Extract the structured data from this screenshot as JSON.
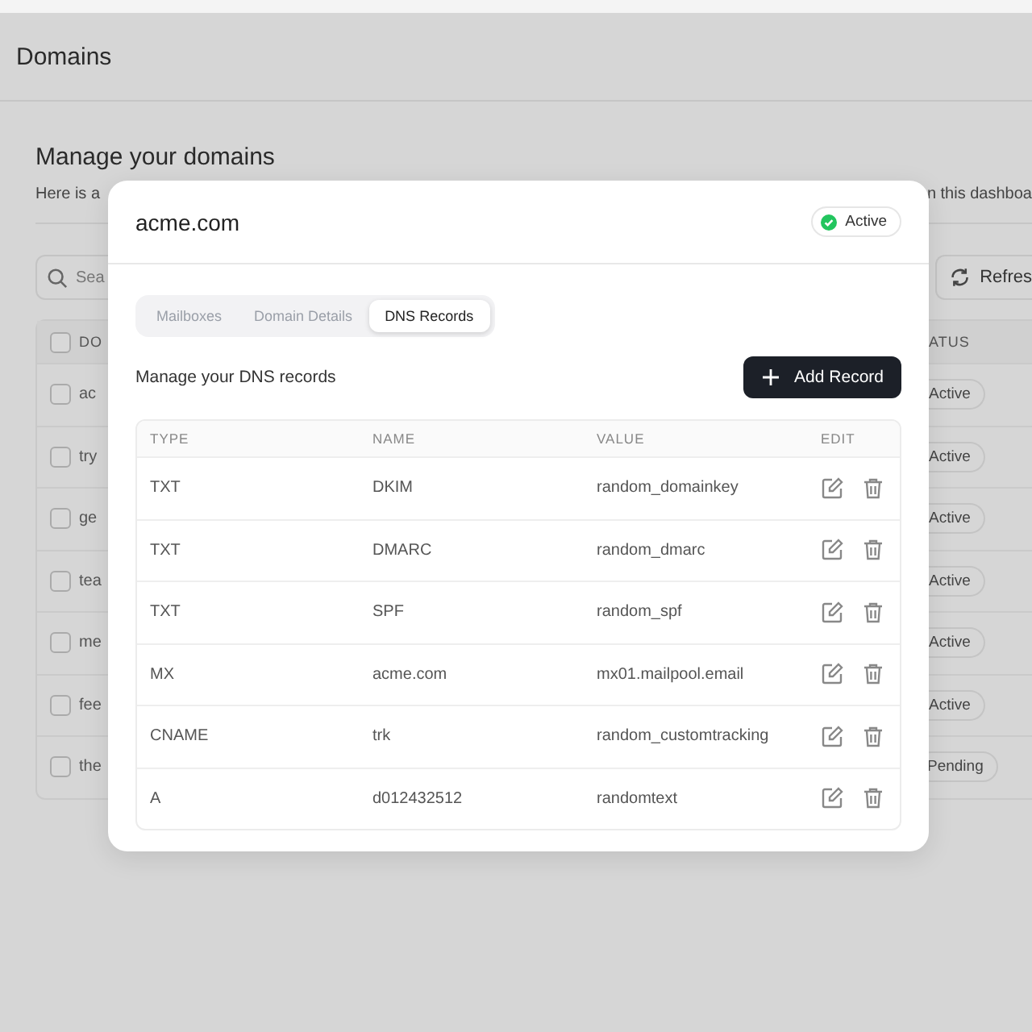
{
  "page": {
    "title": "Domains",
    "heading": "Manage your domains",
    "description_start": "Here is a",
    "description_end": "n this dashboa",
    "search": {
      "placeholder": "Sea"
    },
    "refresh_button": "Refres",
    "table": {
      "columns": [
        "DO",
        "ATUS"
      ],
      "header_checkbox": {
        "checked": false
      },
      "rows": [
        {
          "domain": "ac",
          "checked": false,
          "status": "Active",
          "kind": "active"
        },
        {
          "domain": "try",
          "checked": false,
          "status": "Active",
          "kind": "active"
        },
        {
          "domain": "ge",
          "checked": false,
          "status": "Active",
          "kind": "active"
        },
        {
          "domain": "tea",
          "checked": false,
          "status": "Active",
          "kind": "active"
        },
        {
          "domain": "me",
          "checked": false,
          "status": "Active",
          "kind": "active"
        },
        {
          "domain": "fee",
          "checked": false,
          "status": "Active",
          "kind": "active"
        },
        {
          "domain": "the",
          "checked": false,
          "status": "Pending",
          "kind": "pending"
        }
      ]
    }
  },
  "modal": {
    "title": "acme.com",
    "status": {
      "label": "Active",
      "color": "#22c55e"
    },
    "tabs": [
      {
        "label": "Mailboxes",
        "selected": false
      },
      {
        "label": "Domain Details",
        "selected": false
      },
      {
        "label": "DNS Records",
        "selected": true
      }
    ],
    "subheading": "Manage your DNS records",
    "add_button": "Add Record",
    "table": {
      "columns": [
        "TYPE",
        "NAME",
        "VALUE",
        "EDIT"
      ],
      "rows": [
        {
          "type": "TXT",
          "name": "DKIM",
          "value": "random_domainkey"
        },
        {
          "type": "TXT",
          "name": "DMARC",
          "value": "random_dmarc"
        },
        {
          "type": "TXT",
          "name": "SPF",
          "value": "random_spf"
        },
        {
          "type": "MX",
          "name": "acme.com",
          "value": "mx01.mailpool.email"
        },
        {
          "type": "CNAME",
          "name": "trk",
          "value": "random_customtracking"
        },
        {
          "type": "A",
          "name": "d012432512",
          "value": "randomtext"
        }
      ]
    }
  }
}
